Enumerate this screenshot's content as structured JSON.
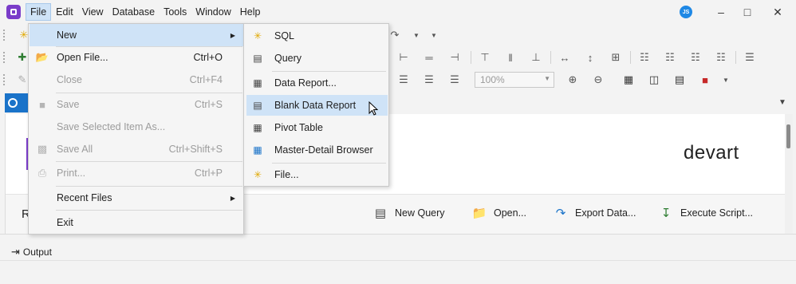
{
  "menubar": {
    "items": [
      "File",
      "Edit",
      "View",
      "Database",
      "Tools",
      "Window",
      "Help"
    ],
    "user_initials": "JS",
    "window_controls": [
      "minimize",
      "maximize",
      "close"
    ]
  },
  "toolbar": {
    "zoom_value": "100%"
  },
  "file_menu": {
    "items": [
      {
        "label": "New",
        "shortcut": "",
        "has_submenu": true,
        "disabled": false
      },
      {
        "label": "Open File...",
        "shortcut": "Ctrl+O",
        "disabled": false
      },
      {
        "label": "Close",
        "shortcut": "Ctrl+F4",
        "disabled": true
      },
      {
        "label": "Save",
        "shortcut": "Ctrl+S",
        "disabled": true
      },
      {
        "label": "Save Selected Item As...",
        "shortcut": "",
        "disabled": true
      },
      {
        "label": "Save All",
        "shortcut": "Ctrl+Shift+S",
        "disabled": true
      },
      {
        "label": "Print...",
        "shortcut": "Ctrl+P",
        "disabled": true
      },
      {
        "label": "Recent Files",
        "shortcut": "",
        "has_submenu": true,
        "disabled": false
      },
      {
        "label": "Exit",
        "shortcut": "",
        "disabled": false
      }
    ]
  },
  "new_submenu": {
    "items": [
      {
        "label": "SQL"
      },
      {
        "label": "Query"
      },
      {
        "label": "Data Report..."
      },
      {
        "label": "Blank Data Report"
      },
      {
        "label": "Pivot Table"
      },
      {
        "label": "Master-Detail Browser"
      },
      {
        "label": "File..."
      }
    ]
  },
  "start_page": {
    "title_fragment": "R",
    "brand": "devart",
    "quick_actions": [
      "New Query",
      "Open...",
      "Export Data...",
      "Execute Script..."
    ]
  },
  "output_panel": {
    "tab_label": "Output"
  },
  "colors": {
    "accent": "#1a73c9",
    "highlight": "#cfe3f7",
    "brand_purple": "#7a3cc9"
  }
}
